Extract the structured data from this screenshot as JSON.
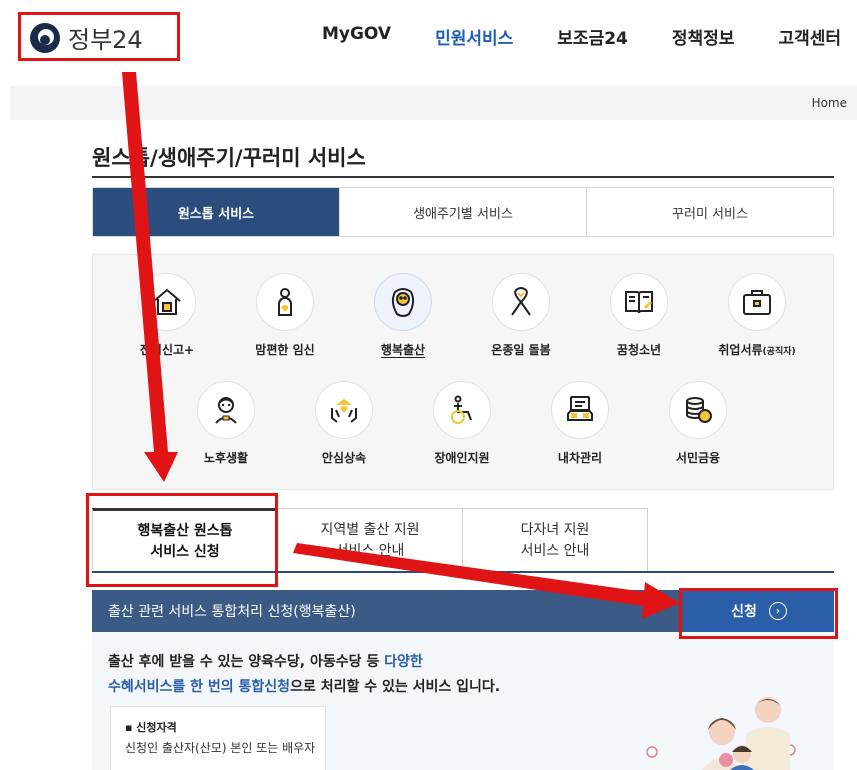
{
  "header": {
    "logo_text": "정부24",
    "nav": [
      "MyGOV",
      "민원서비스",
      "보조금24",
      "정책정보",
      "고객센터"
    ],
    "nav_active_index": 1
  },
  "breadcrumb": {
    "home": "Home"
  },
  "page_title": "원스톱/생애주기/꾸러미 서비스",
  "top_tabs": [
    "원스톱 서비스",
    "생애주기별 서비스",
    "꾸러미 서비스"
  ],
  "services": [
    {
      "label": "전입신고+",
      "icon": "house-icon"
    },
    {
      "label": "맘편한 임신",
      "icon": "pregnant-icon"
    },
    {
      "label": "행복출산",
      "icon": "baby-icon",
      "selected": true
    },
    {
      "label": "온종일 돌봄",
      "icon": "ribbon-icon"
    },
    {
      "label": "꿈청소년",
      "icon": "book-icon"
    },
    {
      "label": "취업서류",
      "label_small": "(공직자)",
      "icon": "briefcase-icon"
    },
    {
      "label": "노후생활",
      "icon": "elder-icon"
    },
    {
      "label": "안심상속",
      "icon": "hands-icon"
    },
    {
      "label": "장애인지원",
      "icon": "wheelchair-icon"
    },
    {
      "label": "내차관리",
      "icon": "car-icon"
    },
    {
      "label": "서민금융",
      "icon": "coins-icon"
    }
  ],
  "sub_tabs": [
    {
      "line1": "행복출산 원스톱",
      "line2": "서비스 신청"
    },
    {
      "line1": "지역별 출산 지원",
      "line2": "서비스 안내"
    },
    {
      "line1": "다자녀 지원",
      "line2": "서비스 안내"
    }
  ],
  "banner": {
    "text": "출산 관련 서비스 통합처리 신청(행복출산)",
    "button_label": "신청",
    "button_icon": "chevron-right-icon"
  },
  "description": {
    "line1_a": "출산 후에 받을 수 있는 양육수당, 아동수당 등 ",
    "line1_b": "다양한",
    "line2_a": "수혜서비스를 한 번의 통합신청",
    "line2_b": "으로 처리할 수 있는 서비스 입니다."
  },
  "qualification": {
    "title": "▪ 신청자격",
    "text": "신청인 출산자(산모) 본인 또는 배우자"
  },
  "colors": {
    "primary_navy": "#2b4d7e",
    "banner": "#3c5a86",
    "apply_button": "#2a5ea9",
    "nav_active": "#1f5fb5",
    "annotation_red": "#e01414"
  }
}
